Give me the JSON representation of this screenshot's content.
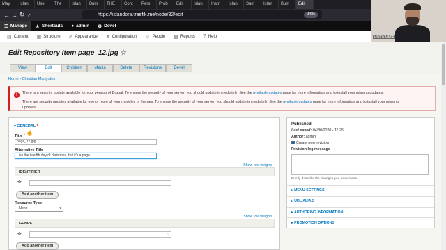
{
  "browser": {
    "tabs": [
      "May",
      "Islan",
      "Use",
      "The",
      "Islan",
      "Bum",
      "THE",
      "Cont",
      "Pers",
      "Prob",
      "Edit",
      "Islan",
      "Instr",
      "Islan",
      "Sam",
      "Islan",
      "Bum",
      "Edit"
    ],
    "active_tab_index": 17,
    "url_prefix": "https://islandora.",
    "url_host": "traefik.me",
    "url_path": "/node/32/edit",
    "zoom": "93%"
  },
  "admin_toolbar": {
    "manage": "Manage",
    "shortcuts": "Shortcuts",
    "user": "admin",
    "devel": "Devel"
  },
  "admin_menu": [
    "Content",
    "Structure",
    "Appearance",
    "Configuration",
    "People",
    "Reports",
    "Help"
  ],
  "page": {
    "title": "Edit Repository Item page_12.jpg",
    "tabs": [
      "View",
      "Edit",
      "Children",
      "Media",
      "Delete",
      "Revisions",
      "Devel"
    ],
    "active_tab": "Edit",
    "breadcrumb": [
      "Home",
      "Christian Martyrdom"
    ]
  },
  "messages": {
    "line1_pre": "There is a security update available for your version of Drupal. To ensure the security of your server, you should update immediately! See the ",
    "line1_link": "available updates",
    "line1_post": " page for more information and to install your missing updates.",
    "line2_pre": "There are security updates available for one or more of your modules or themes. To ensure the security of your server, you should update immediately! See the ",
    "line2_link": "available updates",
    "line2_post": " page for more information and to install your missing",
    "line3": "updates."
  },
  "form": {
    "general_label": "GENERAL",
    "title_label": "Title",
    "title_value": "page_12.jpg",
    "alt_title_label": "Alternative Title",
    "alt_title_value": "Like the twelfth day of christmas, but it's a page",
    "identifier_label": "IDENTIFIER",
    "show_row_weights": "Show row weights",
    "add_another": "Add another item",
    "resource_type_label": "Resource Type",
    "resource_type_value": "- None -",
    "genre_label": "GENRE"
  },
  "sidebar": {
    "published_label": "Published",
    "last_saved_label": "Last saved:",
    "last_saved_value": "04/30/2020 - 11:25",
    "author_label": "Author:",
    "author_value": "admin",
    "create_revision": "Create new revision",
    "revision_log_label": "Revision log message",
    "revision_help": "Briefly describe the changes you have made.",
    "sections": [
      "MENU SETTINGS",
      "URL ALIAS",
      "AUTHORING INFORMATION",
      "PROMOTION OPTIONS"
    ]
  },
  "webcam": {
    "name": "Danny Lamb"
  },
  "colors": {
    "link": "#0074bd",
    "error": "#d02020",
    "toolbar": "#0f0f0f"
  }
}
